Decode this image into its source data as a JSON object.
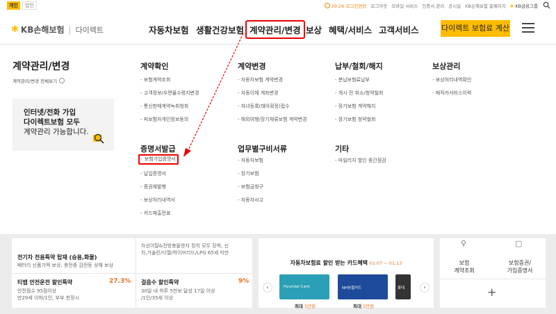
{
  "topbar": {
    "personal": "개인",
    "corporate": "법인",
    "timer": "29:26 로그인연장",
    "links": [
      "로그아웃",
      "모바일 서비스",
      "인증서 관리",
      "공시실",
      "KB손해보험 홈페이지"
    ],
    "group_label": "KB금융그룹"
  },
  "header": {
    "logo_kb": "KB손해보험",
    "logo_sep": "|",
    "logo_direct": "다이렉트",
    "nav": [
      "자동차보험",
      "생활건강보험",
      "계약관리/변경",
      "보상",
      "혜택/서비스",
      "고객서비스"
    ],
    "active_nav": "계약관리/변경",
    "cta": "다이렉트 보험료 계산"
  },
  "mega": {
    "title": "계약관리/변경",
    "view_all": "계약관리/변경 전체보기",
    "promo": [
      "인터넷/전화 가입",
      "다이렉트보험 모두",
      "계약관리 가능합니다."
    ],
    "columns": [
      {
        "heading": "계약확인",
        "items": [
          "- 보험계약조회",
          "- 고객정보/우편물수령지변경",
          "- 통신판매계약녹취청취",
          "- 피보험자개인정보동의"
        ]
      },
      {
        "heading": "계약변경",
        "items": [
          "- 자동차보험 계약변경",
          "- 자동이체 계좌변경",
          "- 자녀등록(태아확정)접수",
          "- 해외여행/장기체류보험 계약변경"
        ]
      },
      {
        "heading": "납부/철회/해지",
        "items": [
          "- 분납보험료납부",
          "- 개시 전 취소/청약철회",
          "- 장기보험 계약해지",
          "- 장기보험 청약철회"
        ]
      },
      {
        "heading": "보상관리",
        "items": [
          "- 보상처리내역확인",
          "- 매직카서비스이력"
        ]
      },
      {
        "heading": "증명서발급",
        "items": [
          "- 보험가입증명서",
          "- 납입증명서",
          "- 증권재발행",
          "- 보상처리내역서",
          "- 카드매출전표"
        ]
      },
      {
        "heading": "업무별구비서류",
        "items": [
          "- 자동차보험",
          "- 장기보험",
          "- 보험금청구",
          "- 자동차사고"
        ]
      },
      {
        "heading": "기타",
        "items": [
          "- 마일리지 할인 중간점검"
        ]
      }
    ]
  },
  "lower": {
    "left": {
      "t1": "전기차 전용특약 탑재 (승용,화물)",
      "d1": "배터리 신품가액 보상, 충전중 감전등 상해 보상",
      "t2": "차선이탈&전방충돌방지 장치 모두 장착, 신",
      "t2b": "차,가솔린/디젤/하이브리드/LPG 65세 미만",
      "t3": "티맵 안전운전 할인특약",
      "pct3": "27.3%",
      "d3a": "안전점수 95점이상",
      "d3b": "만29세 이하/1인, 부부 한정시",
      "t4": "걸음수 할인특약",
      "pct4": "9%",
      "d4a": "30일 내 하루 5천보 달성 17일 이상",
      "d4b": "/1인/35세 이상"
    },
    "card": {
      "title": "자동차보험료 할인 받는 카드혜택",
      "dates": "01.07 ~ 01.13",
      "cards": [
        "Hyundai Card",
        "NH농협카드",
        "롯데"
      ],
      "max1_prefix": "최대",
      "max1_value": "5만원",
      "max2_prefix": "최대",
      "max2_value": "5만원"
    },
    "quick": {
      "q1": [
        "보험",
        "계약조회"
      ],
      "q2": [
        "보험증권/",
        "가입증명서"
      ]
    }
  }
}
